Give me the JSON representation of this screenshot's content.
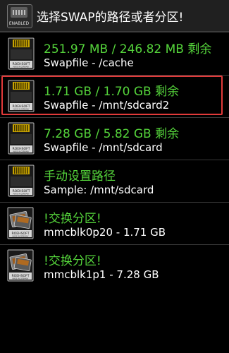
{
  "title_bar": {
    "title": "选择SWAP的路径或者分区!",
    "icon_label": "ENABLED",
    "icon_name": "ram-chip-icon"
  },
  "colors": {
    "background": "#000000",
    "title_bar": "#202020",
    "primary_text": "#55d53b",
    "secondary_text": "#ffffff",
    "selection_border": "#e23a3a"
  },
  "options": [
    {
      "primary": "251.97 MB / 246.82 MB 剩余",
      "secondary": "Swapfile - /cache",
      "icon": "memory-card-icon",
      "icon_text": "ROEHSOFT",
      "icon_subtext": "MADE IN GERMANY",
      "selected": false
    },
    {
      "primary": "1.71 GB / 1.70 GB 剩余",
      "secondary": "Swapfile - /mnt/sdcard2",
      "icon": "memory-card-icon",
      "icon_text": "ROEHSOFT",
      "icon_subtext": "MADE IN GERMANY",
      "selected": true
    },
    {
      "primary": "7.28 GB / 5.82 GB 剩余",
      "secondary": "Swapfile - /mnt/sdcard",
      "icon": "memory-card-icon",
      "icon_text": "ROEHSOFT",
      "icon_subtext": "MADE IN GERMANY",
      "selected": false
    },
    {
      "primary": "手动设置路径",
      "secondary": "Sample: /mnt/sdcard",
      "icon": "memory-card-icon",
      "icon_text": "ROEHSOFT",
      "icon_subtext": "MADE IN GERMANY",
      "selected": false
    },
    {
      "primary": "!交换分区!",
      "secondary": "mmcblk0p20 - 1.71 GB",
      "icon": "sd-card-icon",
      "icon_text": "ROEHSOFT",
      "icon_subtext": "MADE IN GERMANY",
      "selected": false
    },
    {
      "primary": "!交换分区!",
      "secondary": "mmcblk1p1 - 7.28 GB",
      "icon": "sd-card-icon",
      "icon_text": "ROEHSOFT",
      "icon_subtext": "MADE IN GERMANY",
      "selected": false
    }
  ]
}
